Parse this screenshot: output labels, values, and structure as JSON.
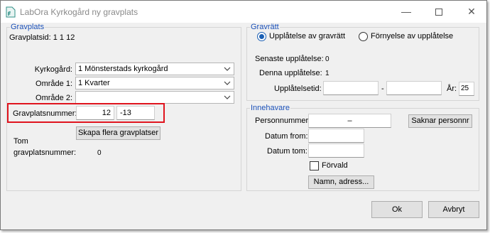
{
  "window": {
    "title": "LabOra Kyrkogård ny gravplats",
    "icon": "document-icon",
    "minimize": "—",
    "close": "✕"
  },
  "gravplats": {
    "title": "Gravplats",
    "id_label": "Gravplatsid: 1 1  12",
    "kyrkogard_label": "Kyrkogård:",
    "kyrkogard_value": "1 Mönsterstads kyrkogård",
    "omrade1_label": "Område 1:",
    "omrade1_value": "1 Kvarter",
    "omrade2_label": "Område 2:",
    "omrade2_value": "",
    "nummer_label": "Gravplatsnummer:",
    "nummer_value": "12",
    "nummer_suffix": "-13",
    "skapa_button": "Skapa flera gravplatser",
    "tom_label_1": "Tom",
    "tom_label_2": "gravplatsnummer:",
    "tom_value": "0"
  },
  "gravratt": {
    "title": "Gravrätt",
    "radio1_label": "Upplåtelse av gravrätt",
    "radio2_label": "Förnyelse av upplåtelse",
    "selected": "Upplåtelse av gravrätt",
    "senaste_label": "Senaste upplåtelse:",
    "senaste_value": "0",
    "denna_label": "Denna upplåtelse:",
    "denna_value": "1",
    "tid_label": "Upplåtelsetid:",
    "tid_from": "",
    "tid_dash": "-",
    "tid_to": "",
    "ar_label": "År:",
    "ar_value": "25"
  },
  "innehavare": {
    "title": "Innehavare",
    "personnummer_label": "Personnummer:",
    "personnummer_value": "–",
    "saknar_button": "Saknar personnr",
    "datum_from_label": "Datum from:",
    "datum_from_value": "",
    "datum_tom_label": "Datum tom:",
    "datum_tom_value": "",
    "forvald_label": "Förvald",
    "namn_button": "Namn, adress..."
  },
  "footer": {
    "ok_button": "Ok",
    "avbryt_button": "Avbryt"
  },
  "colors": {
    "group_title": "#1a50b8",
    "highlight": "#e0141e",
    "radio_accent": "#1a5fb4"
  }
}
